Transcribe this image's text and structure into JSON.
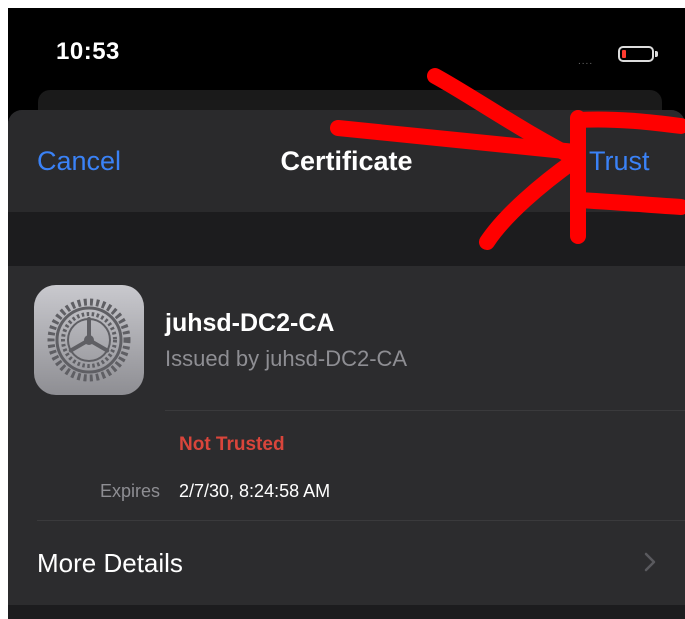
{
  "status_bar": {
    "time": "10:53",
    "signal": "....",
    "battery_level": 0.15,
    "battery_color": "#ff3b30"
  },
  "nav": {
    "cancel_label": "Cancel",
    "title": "Certificate",
    "trust_label": "Trust"
  },
  "certificate": {
    "icon": "settings-gear-icon",
    "name": "juhsd-DC2-CA",
    "issuer": "Issued by juhsd-DC2-CA",
    "status": "Not Trusted",
    "expires_label": "Expires",
    "expires_value": "2/7/30, 8:24:58 AM"
  },
  "more_details": {
    "label": "More Details",
    "icon": "chevron-right-icon"
  },
  "colors": {
    "accent": "#3a82f7",
    "not_trusted": "#d9453b",
    "annotation": "#ff0000"
  }
}
